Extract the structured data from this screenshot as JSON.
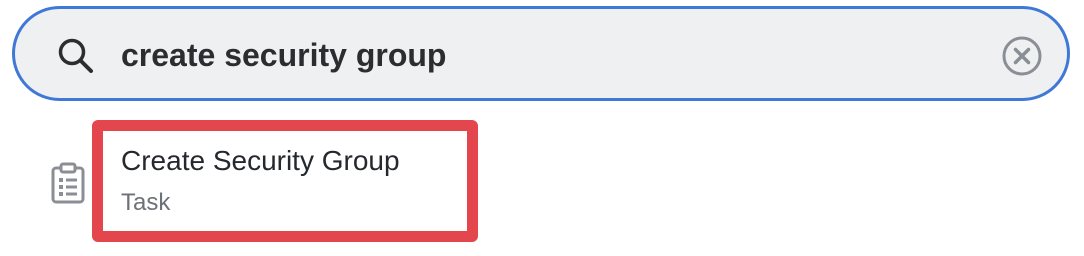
{
  "search": {
    "value": "create security group",
    "icon": "search-icon",
    "clear_icon": "close-circle-icon"
  },
  "results": [
    {
      "title": "Create Security Group",
      "subtitle": "Task",
      "icon": "clipboard-list-icon"
    }
  ],
  "colors": {
    "search_border": "#3f78d6",
    "search_background": "#eff0f2",
    "highlight_border": "#e3464c",
    "icon_gray": "#8a8f96"
  }
}
